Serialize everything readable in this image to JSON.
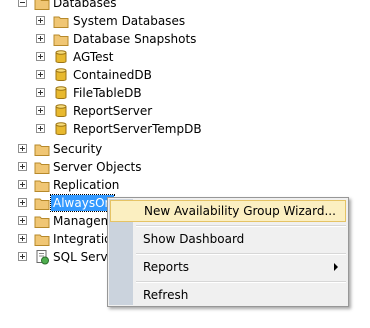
{
  "tree": {
    "databases_label": "Databases",
    "databases_children": [
      "System Databases",
      "Database Snapshots",
      "AGTest",
      "ContainedDB",
      "FileTableDB",
      "ReportServer",
      "ReportServerTempDB"
    ],
    "security_label": "Security",
    "server_objects_label": "Server Objects",
    "replication_label": "Replication",
    "alwayson_label": "AlwaysOn",
    "management_label": "Managem",
    "integration_label": "Integratio",
    "sql_agent_label": "SQL Serve"
  },
  "context_menu": {
    "items": [
      "New Availability Group Wizard...",
      "Show Dashboard",
      "Reports",
      "Refresh"
    ]
  },
  "colors": {
    "selection": "#3399ff",
    "menu_highlight": "#fbefc1",
    "menu_gutter": "#cbd3dd",
    "folder": "#f0c674",
    "database": "#e8b92f"
  }
}
